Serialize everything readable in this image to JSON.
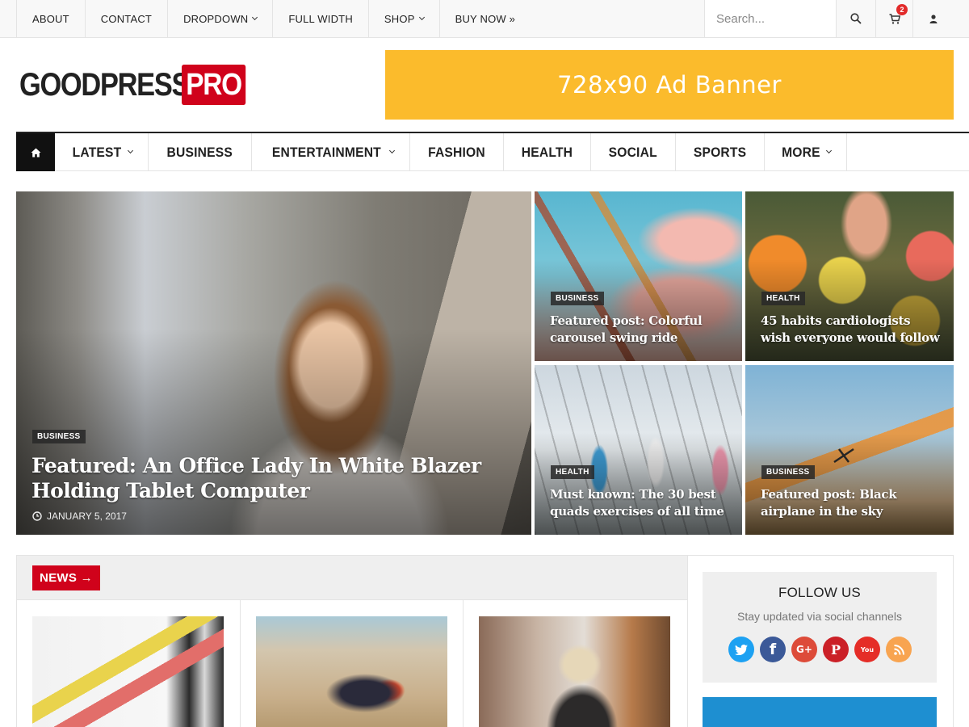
{
  "topbar": {
    "links": [
      {
        "label": "ABOUT",
        "dropdown": false
      },
      {
        "label": "CONTACT",
        "dropdown": false
      },
      {
        "label": "DROPDOWN",
        "dropdown": true
      },
      {
        "label": "FULL WIDTH",
        "dropdown": false
      },
      {
        "label": "SHOP",
        "dropdown": true
      },
      {
        "label": "BUY NOW »",
        "dropdown": false
      }
    ],
    "search_placeholder": "Search...",
    "cart_count": "2",
    "icons": [
      "search-icon",
      "cart-icon",
      "user-icon"
    ]
  },
  "header": {
    "logo_main": "GOODPRESS",
    "logo_badge": "PRO",
    "ad_text": "728x90 Ad Banner",
    "colors": {
      "brand_red": "#d0021b",
      "ad_yellow": "#fbbb2c"
    }
  },
  "mainnav": {
    "home_icon": "home-icon",
    "items": [
      {
        "label": "LATEST",
        "dropdown": true
      },
      {
        "label": "BUSINESS",
        "dropdown": false
      },
      {
        "label": "ENTERTAINMENT",
        "dropdown": true
      },
      {
        "label": "FASHION",
        "dropdown": false
      },
      {
        "label": "HEALTH",
        "dropdown": false
      },
      {
        "label": "SOCIAL",
        "dropdown": false
      },
      {
        "label": "SPORTS",
        "dropdown": false
      },
      {
        "label": "MORE",
        "dropdown": true
      }
    ]
  },
  "featured": {
    "main": {
      "category": "BUSINESS",
      "title": "Featured: An Office Lady In White Blazer Holding Tablet Computer",
      "date": "JANUARY 5, 2017"
    },
    "grid": [
      {
        "category": "BUSINESS",
        "title": "Featured post: Colorful carousel swing ride"
      },
      {
        "category": "HEALTH",
        "title": "45 habits cardiologists wish everyone would follow"
      },
      {
        "category": "HEALTH",
        "title": "Must known: The 30 best quads exercises of all time"
      },
      {
        "category": "BUSINESS",
        "title": "Featured post: Black airplane in the sky"
      }
    ]
  },
  "news": {
    "label": "NEWS →"
  },
  "sidebar": {
    "follow_title": "FOLLOW US",
    "follow_subtitle": "Stay updated via social channels",
    "socials": [
      {
        "name": "twitter-icon",
        "glyph": "t",
        "color": "#1da1f2"
      },
      {
        "name": "facebook-icon",
        "glyph": "f",
        "color": "#3b5998"
      },
      {
        "name": "google-plus-icon",
        "glyph": "G+",
        "color": "#dd4b39"
      },
      {
        "name": "pinterest-icon",
        "glyph": "P",
        "color": "#cb2027"
      },
      {
        "name": "youtube-icon",
        "glyph": "You",
        "color": "#e52d27"
      },
      {
        "name": "rss-icon",
        "glyph": ")",
        "color": "#f8a450"
      }
    ]
  }
}
